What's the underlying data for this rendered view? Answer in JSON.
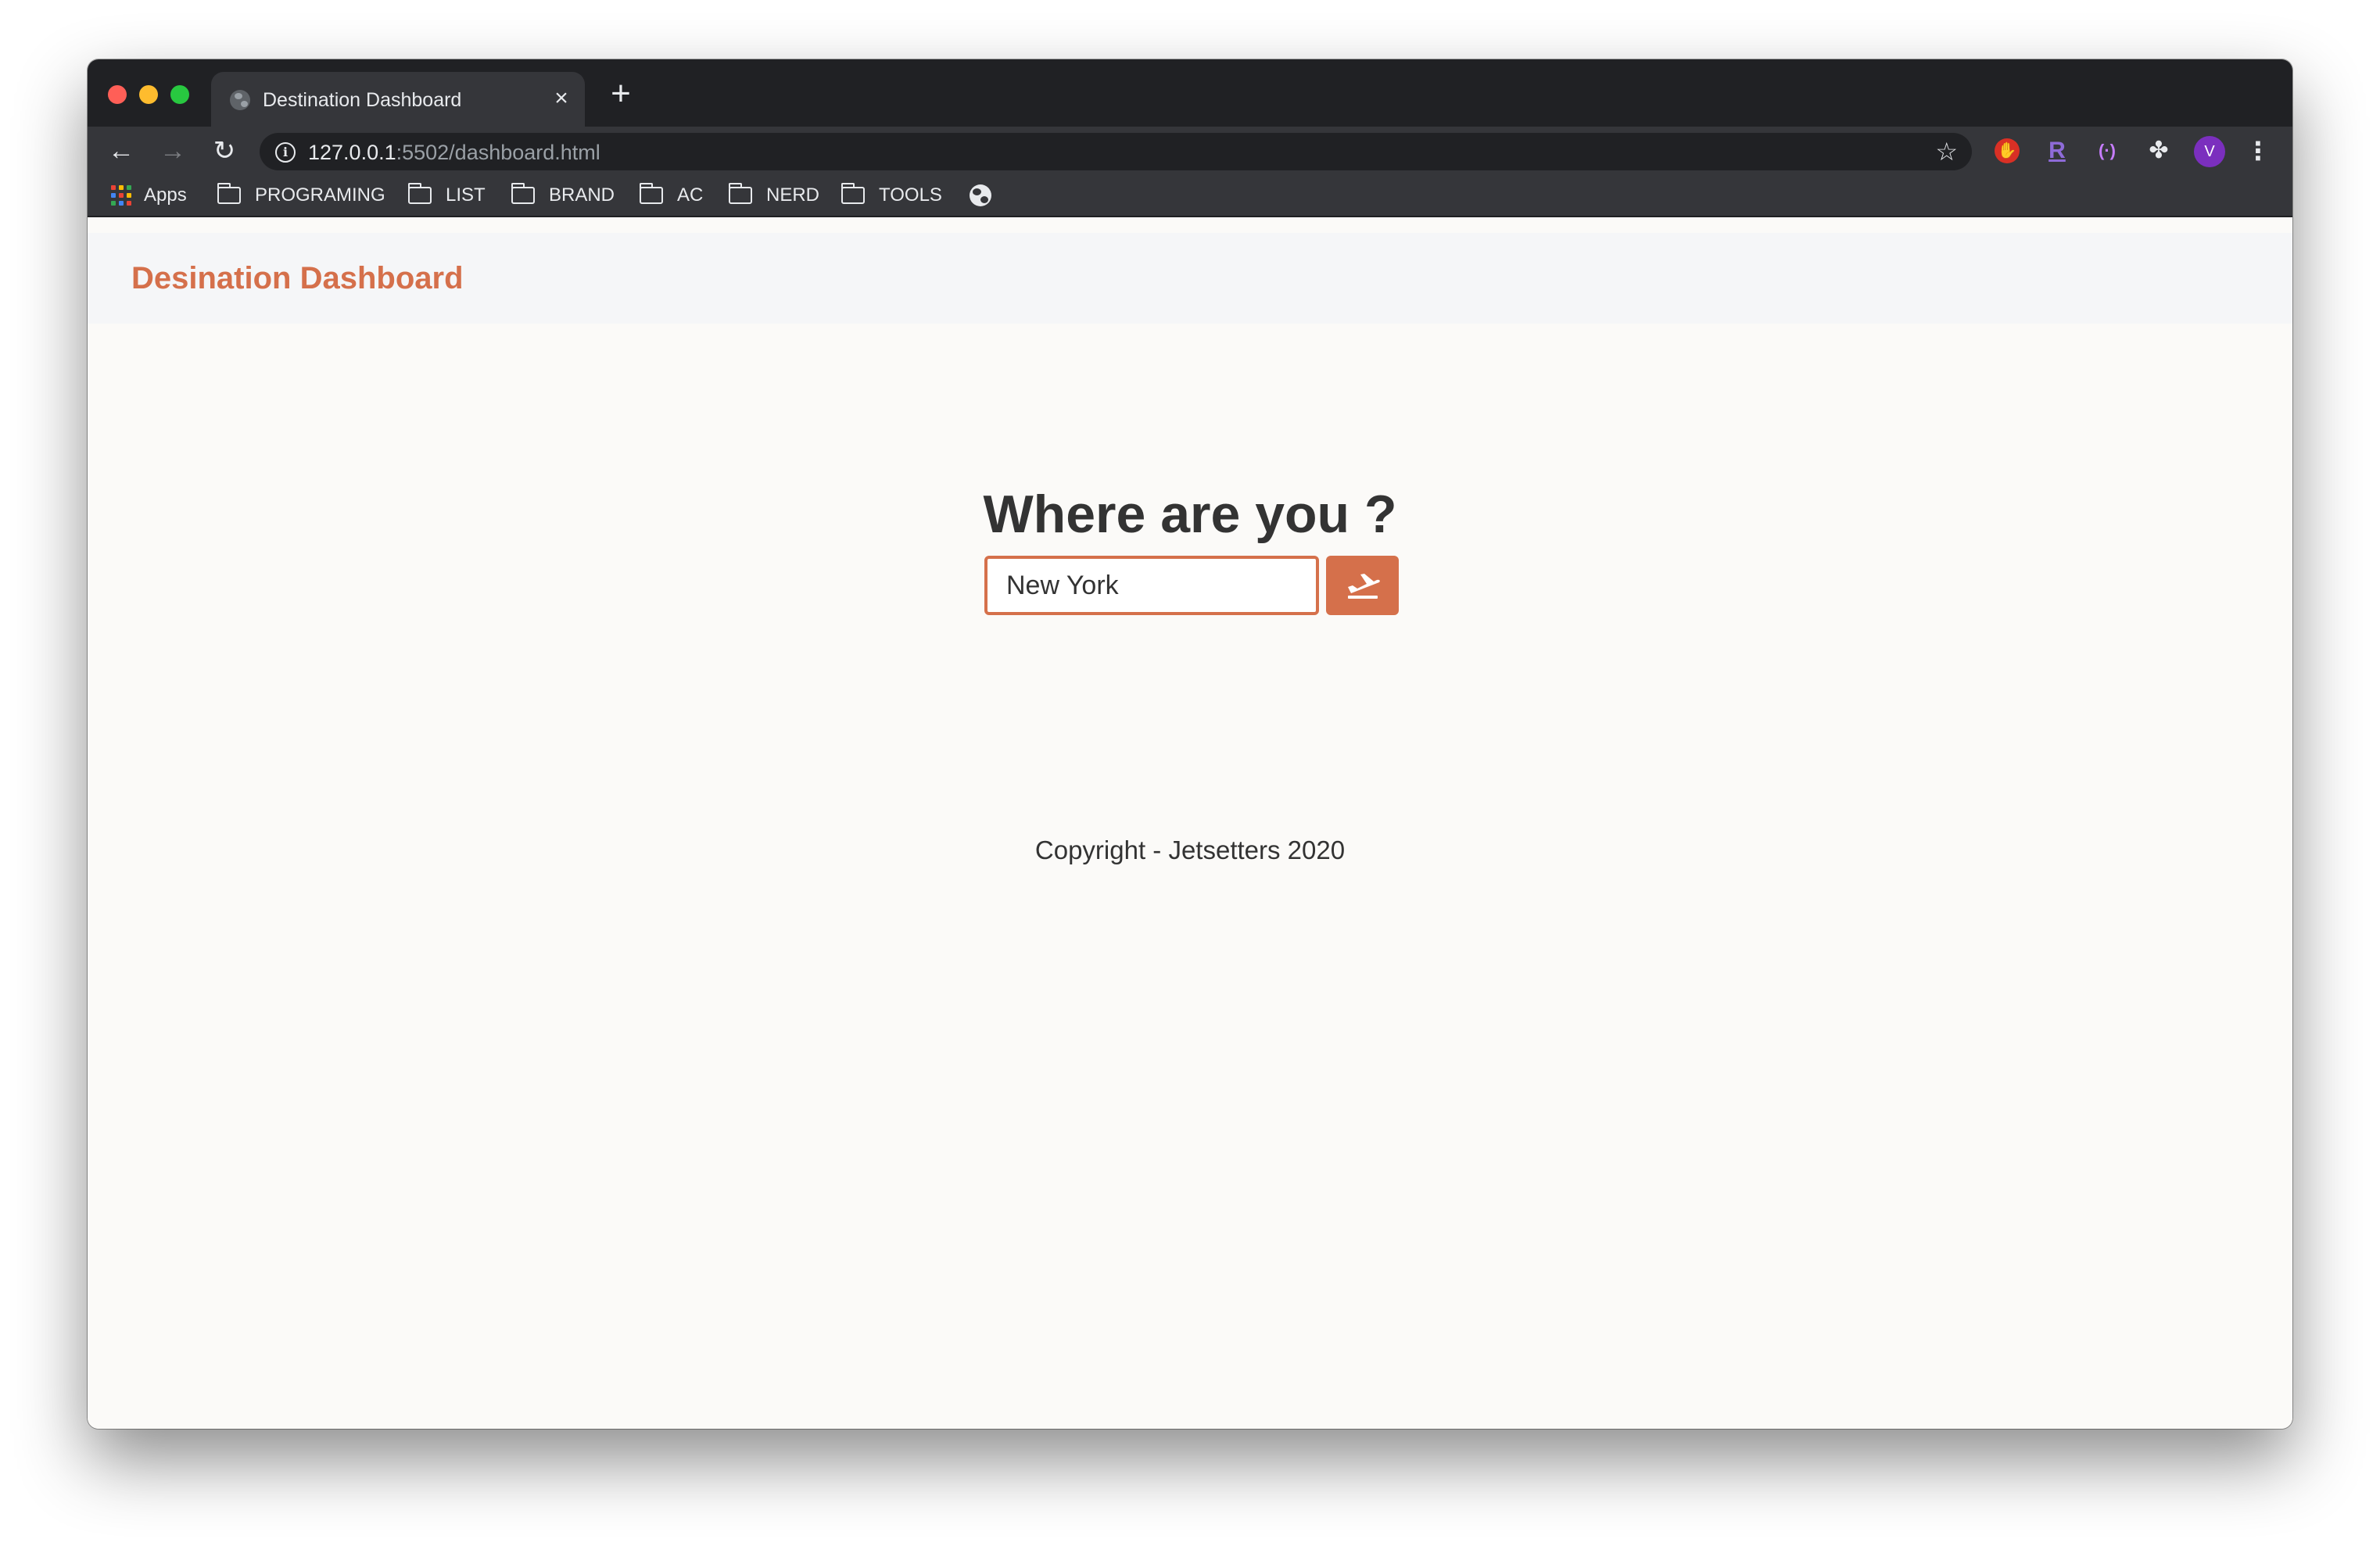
{
  "browser": {
    "tab_title": "Destination Dashboard",
    "tab_close_glyph": "×",
    "new_tab_glyph": "+",
    "back_glyph": "←",
    "forward_glyph": "→",
    "reload_glyph": "↻",
    "info_glyph": "i",
    "star_glyph": "☆",
    "url_host": "127.0.0.1",
    "url_path": ":5502/dashboard.html",
    "avatar_initial": "V",
    "menu_glyph": "⋮",
    "extensions": {
      "hand_glyph": "✋",
      "r_label": "R",
      "radio_label": "(·)",
      "puzzle_glyph": "✤"
    },
    "bookmarks": [
      {
        "label": "Apps"
      },
      {
        "label": "PROGRAMING"
      },
      {
        "label": "LIST"
      },
      {
        "label": "BRAND"
      },
      {
        "label": "AC"
      },
      {
        "label": "NERD"
      },
      {
        "label": "TOOLS"
      }
    ],
    "apps_grid_colors": [
      "#ea4335",
      "#fbbc04",
      "#34a853",
      "#4285f4",
      "#ea4335",
      "#fbbc04",
      "#34a853",
      "#4285f4",
      "#ea4335"
    ]
  },
  "page": {
    "brand": "Desination Dashboard",
    "brand_color": "#d5704b",
    "hero_title": "Where are you ?",
    "location_input": {
      "value": "New York"
    },
    "copyright": "Copyright - Jetsetters 2020"
  }
}
